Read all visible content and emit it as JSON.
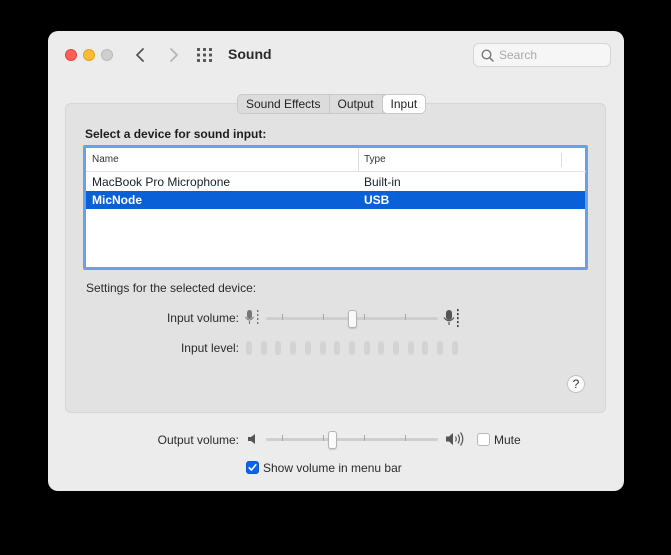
{
  "window": {
    "title": "Sound"
  },
  "search": {
    "placeholder": "Search"
  },
  "tabs": [
    {
      "label": "Sound Effects",
      "active": false
    },
    {
      "label": "Output",
      "active": false
    },
    {
      "label": "Input",
      "active": true
    }
  ],
  "input_section": {
    "heading": "Select a device for sound input:",
    "columns": [
      "Name",
      "Type"
    ],
    "devices": [
      {
        "name": "MacBook Pro Microphone",
        "type": "Built-in",
        "selected": false
      },
      {
        "name": "MicNode",
        "type": "USB",
        "selected": true
      }
    ],
    "settings_label": "Settings for the selected device:",
    "input_volume_label": "Input volume:",
    "input_volume_value": 0.5,
    "input_level_label": "Input level:",
    "input_level_active_bars": 0,
    "help_label": "?"
  },
  "output_volume": {
    "label": "Output volume:",
    "value": 0.38,
    "mute_label": "Mute",
    "mute_checked": false
  },
  "menu_bar": {
    "label": "Show volume in menu bar",
    "checked": true
  },
  "colors": {
    "accent": "#0a60d6",
    "close": "#fe5f57",
    "minimize": "#febc2e",
    "zoom": "#cfcfcf"
  },
  "icons": {
    "back": "chevron-left-icon",
    "forward": "chevron-right-icon",
    "all_prefs": "grid-icon",
    "search": "magnifier-icon",
    "mic_low": "microphone-low-icon",
    "mic_high": "microphone-high-icon",
    "speaker_low": "speaker-low-icon",
    "speaker_high": "speaker-high-icon"
  }
}
